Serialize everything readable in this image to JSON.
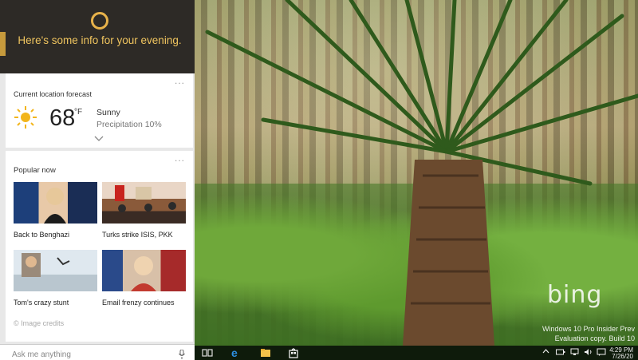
{
  "cortana": {
    "greeting": "Here's some info for your evening.",
    "colors": {
      "header_bg": "#2d2a26",
      "accent": "#e7b24a",
      "greeting_text": "#f0c55f"
    }
  },
  "weather": {
    "title": "Current location forecast",
    "icon": "sun-icon",
    "temperature": "68",
    "unit": "°F",
    "condition": "Sunny",
    "precipitation": "Precipitation 10%",
    "more": "...",
    "expand_icon": "chevron-down-icon"
  },
  "news": {
    "title": "Popular now",
    "more": "...",
    "items": [
      {
        "caption": "Back to Benghazi"
      },
      {
        "caption": "Turks strike ISIS, PKK"
      },
      {
        "caption": "Tom's crazy stunt"
      },
      {
        "caption": "Email frenzy continues"
      }
    ],
    "credits": "© Image credits"
  },
  "search": {
    "placeholder": "Ask me anything",
    "icon": "microphone-icon"
  },
  "desktop": {
    "logo_text": "bing",
    "watermark_line1": "Windows 10 Pro Insider Prev",
    "watermark_line2": "Evaluation copy. Build 10"
  },
  "taskbar": {
    "icons": [
      "task-view-icon",
      "edge-icon",
      "file-explorer-icon",
      "store-icon"
    ],
    "tray_icons": [
      "chevron-up-icon",
      "battery-icon",
      "network-icon",
      "volume-icon",
      "action-center-icon"
    ],
    "time": "4:29 PM",
    "date": "7/26/20"
  }
}
